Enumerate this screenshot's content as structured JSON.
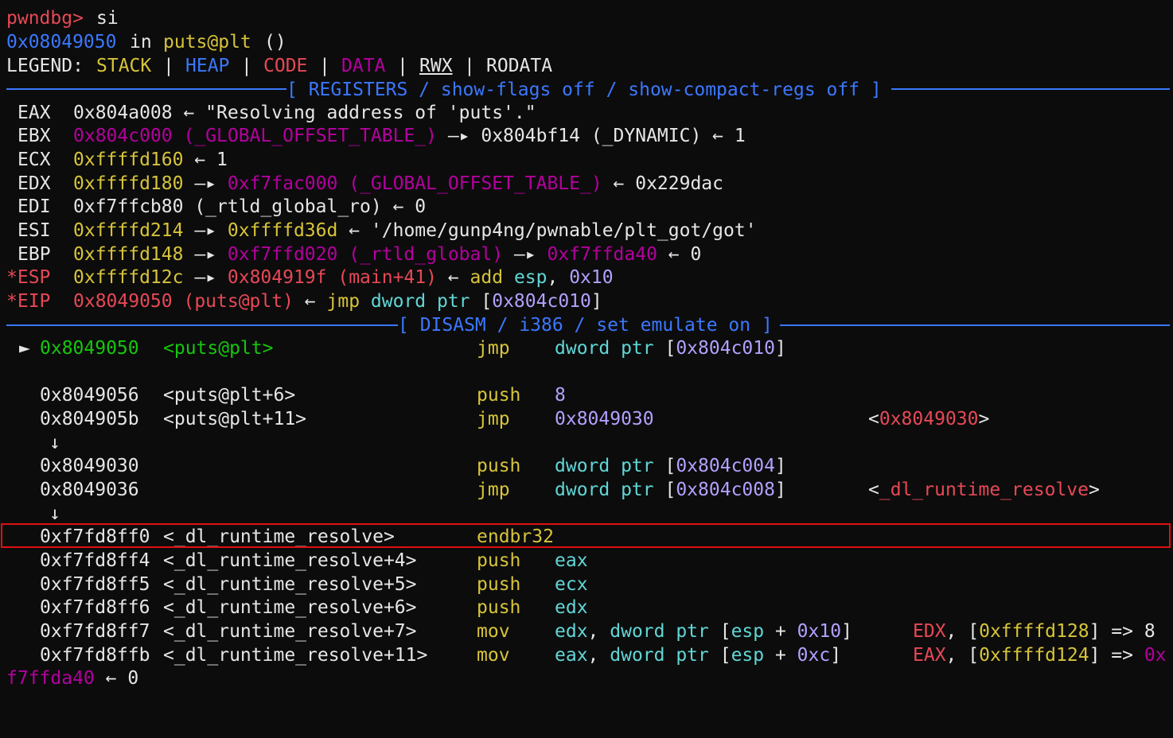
{
  "prompt": {
    "name": "pwndbg>",
    "command": "si"
  },
  "location": {
    "address": "0x08049050",
    "in": "in",
    "symbol": "puts@plt",
    "parens": "()"
  },
  "legend": {
    "label": "LEGEND:",
    "sep": "|",
    "stack": "STACK",
    "heap": "HEAP",
    "code": "CODE",
    "data": "DATA",
    "rwx": "RWX",
    "rodata": "RODATA"
  },
  "registers_header": "[ REGISTERS / show-flags off / show-compact-regs off ]",
  "registers": [
    {
      "name": "EAX",
      "parts": [
        [
          "w",
          "0x804a008 ← \"Resolving address of 'puts'.\""
        ]
      ]
    },
    {
      "name": "EBX",
      "parts": [
        [
          "magenta",
          "0x804c000 (_GLOBAL_OFFSET_TABLE_)"
        ],
        [
          "w",
          " —▸ 0x804bf14 (_DYNAMIC) ← 1"
        ]
      ]
    },
    {
      "name": "ECX",
      "parts": [
        [
          "yellow",
          "0xffffd160"
        ],
        [
          "w",
          " ← 1"
        ]
      ]
    },
    {
      "name": "EDX",
      "parts": [
        [
          "yellow",
          "0xffffd180"
        ],
        [
          "w",
          " —▸ "
        ],
        [
          "magenta",
          "0xf7fac000 (_GLOBAL_OFFSET_TABLE_)"
        ],
        [
          "w",
          " ← 0x229dac"
        ]
      ]
    },
    {
      "name": "EDI",
      "parts": [
        [
          "w",
          "0xf7ffcb80 (_rtld_global_ro) ← 0"
        ]
      ]
    },
    {
      "name": "ESI",
      "parts": [
        [
          "yellow",
          "0xffffd214"
        ],
        [
          "w",
          " —▸ "
        ],
        [
          "yellow",
          "0xffffd36d"
        ],
        [
          "w",
          " ← '/home/gunp4ng/pwnable/plt_got/got'"
        ]
      ]
    },
    {
      "name": "EBP",
      "parts": [
        [
          "yellow",
          "0xffffd148"
        ],
        [
          "w",
          " —▸ "
        ],
        [
          "magenta",
          "0xf7ffd020 (_rtld_global)"
        ],
        [
          "w",
          " —▸ "
        ],
        [
          "magenta",
          "0xf7ffda40"
        ],
        [
          "w",
          " ← 0"
        ]
      ]
    },
    {
      "name": "*ESP",
      "changed": true,
      "parts": [
        [
          "yellow",
          "0xffffd12c"
        ],
        [
          "w",
          " —▸ "
        ],
        [
          "red",
          "0x804919f (main+41)"
        ],
        [
          "w",
          " ← "
        ],
        [
          "yellow",
          "add"
        ],
        [
          "w",
          " "
        ],
        [
          "cyan",
          "esp"
        ],
        [
          "w",
          ", "
        ],
        [
          "violet",
          "0x10"
        ]
      ]
    },
    {
      "name": "*EIP",
      "changed": true,
      "parts": [
        [
          "red",
          "0x8049050 (puts@plt)"
        ],
        [
          "w",
          " ← "
        ],
        [
          "yellow",
          "jmp"
        ],
        [
          "w",
          " "
        ],
        [
          "cyan",
          "dword ptr"
        ],
        [
          "w",
          " ["
        ],
        [
          "violet",
          "0x804c010"
        ],
        [
          "w",
          "]"
        ]
      ]
    }
  ],
  "disasm_header": "[ DISASM / i386 / set emulate on ]",
  "current_marker": "►",
  "branch_arrow": "↓",
  "disasm": [
    {
      "row": 14,
      "current": true,
      "addr": "0x8049050",
      "sym": "<puts@plt>",
      "mnem": "jmp",
      "ops": [
        [
          "cyan",
          "dword ptr"
        ],
        [
          "w",
          " ["
        ],
        [
          "violet",
          "0x804c010"
        ],
        [
          "w",
          "]"
        ]
      ]
    },
    {
      "row": 16,
      "addr": "0x8049056",
      "sym": "<puts@plt+6>",
      "mnem": "push",
      "ops": [
        [
          "violet",
          "8"
        ]
      ]
    },
    {
      "row": 17,
      "addr": "0x804905b",
      "sym": "<puts@plt+11>",
      "mnem": "jmp",
      "ops": [
        [
          "violet",
          "0x8049030"
        ]
      ],
      "note_col": 1091,
      "note": [
        [
          "w",
          "<"
        ],
        [
          "red",
          "0x8049030"
        ],
        [
          "w",
          ">"
        ]
      ]
    },
    {
      "row": 19,
      "addr": "0x8049030",
      "sym": "",
      "mnem": "push",
      "ops": [
        [
          "cyan",
          "dword ptr"
        ],
        [
          "w",
          " ["
        ],
        [
          "violet",
          "0x804c004"
        ],
        [
          "w",
          "]"
        ]
      ]
    },
    {
      "row": 20,
      "addr": "0x8049036",
      "sym": "",
      "mnem": "jmp",
      "ops": [
        [
          "cyan",
          "dword ptr"
        ],
        [
          "w",
          " ["
        ],
        [
          "violet",
          "0x804c008"
        ],
        [
          "w",
          "]"
        ]
      ],
      "note_col": 1091,
      "note": [
        [
          "w",
          "<"
        ],
        [
          "red",
          "_dl_runtime_resolve"
        ],
        [
          "w",
          ">"
        ]
      ]
    },
    {
      "row": 22,
      "highlight": true,
      "addr": "0xf7fd8ff0",
      "sym": "<_dl_runtime_resolve>",
      "mnem": "endbr32",
      "ops": []
    },
    {
      "row": 23,
      "addr": "0xf7fd8ff4",
      "sym": "<_dl_runtime_resolve+4>",
      "mnem": "push",
      "ops": [
        [
          "cyan",
          "eax"
        ]
      ]
    },
    {
      "row": 24,
      "addr": "0xf7fd8ff5",
      "sym": "<_dl_runtime_resolve+5>",
      "mnem": "push",
      "ops": [
        [
          "cyan",
          "ecx"
        ]
      ]
    },
    {
      "row": 25,
      "addr": "0xf7fd8ff6",
      "sym": "<_dl_runtime_resolve+6>",
      "mnem": "push",
      "ops": [
        [
          "cyan",
          "edx"
        ]
      ]
    },
    {
      "row": 26,
      "addr": "0xf7fd8ff7",
      "sym": "<_dl_runtime_resolve+7>",
      "mnem": "mov",
      "ops": [
        [
          "cyan",
          "edx"
        ],
        [
          "w",
          ", "
        ],
        [
          "cyan",
          "dword ptr"
        ],
        [
          "w",
          " ["
        ],
        [
          "cyan",
          "esp"
        ],
        [
          "w",
          " + "
        ],
        [
          "violet",
          "0x10"
        ],
        [
          "w",
          "]"
        ]
      ],
      "note_col": 1147,
      "note": [
        [
          "red",
          "EDX"
        ],
        [
          "w",
          ", ["
        ],
        [
          "yellow",
          "0xffffd128"
        ],
        [
          "w",
          "] => 8"
        ]
      ]
    },
    {
      "row": 27,
      "addr": "0xf7fd8ffb",
      "sym": "<_dl_runtime_resolve+11>",
      "mnem": "mov",
      "ops": [
        [
          "cyan",
          "eax"
        ],
        [
          "w",
          ", "
        ],
        [
          "cyan",
          "dword ptr"
        ],
        [
          "w",
          " ["
        ],
        [
          "cyan",
          "esp"
        ],
        [
          "w",
          " + "
        ],
        [
          "violet",
          "0xc"
        ],
        [
          "w",
          "]"
        ]
      ],
      "note_col": 1147,
      "note": [
        [
          "red",
          "EAX"
        ],
        [
          "w",
          ", ["
        ],
        [
          "yellow",
          "0xffffd124"
        ],
        [
          "w",
          "] => "
        ],
        [
          "magenta",
          "0x"
        ]
      ]
    }
  ],
  "arrows": [
    18,
    21
  ],
  "wrap_tail": [
    [
      "magenta",
      "f7ffda40"
    ],
    [
      "w",
      " ← 0"
    ]
  ]
}
